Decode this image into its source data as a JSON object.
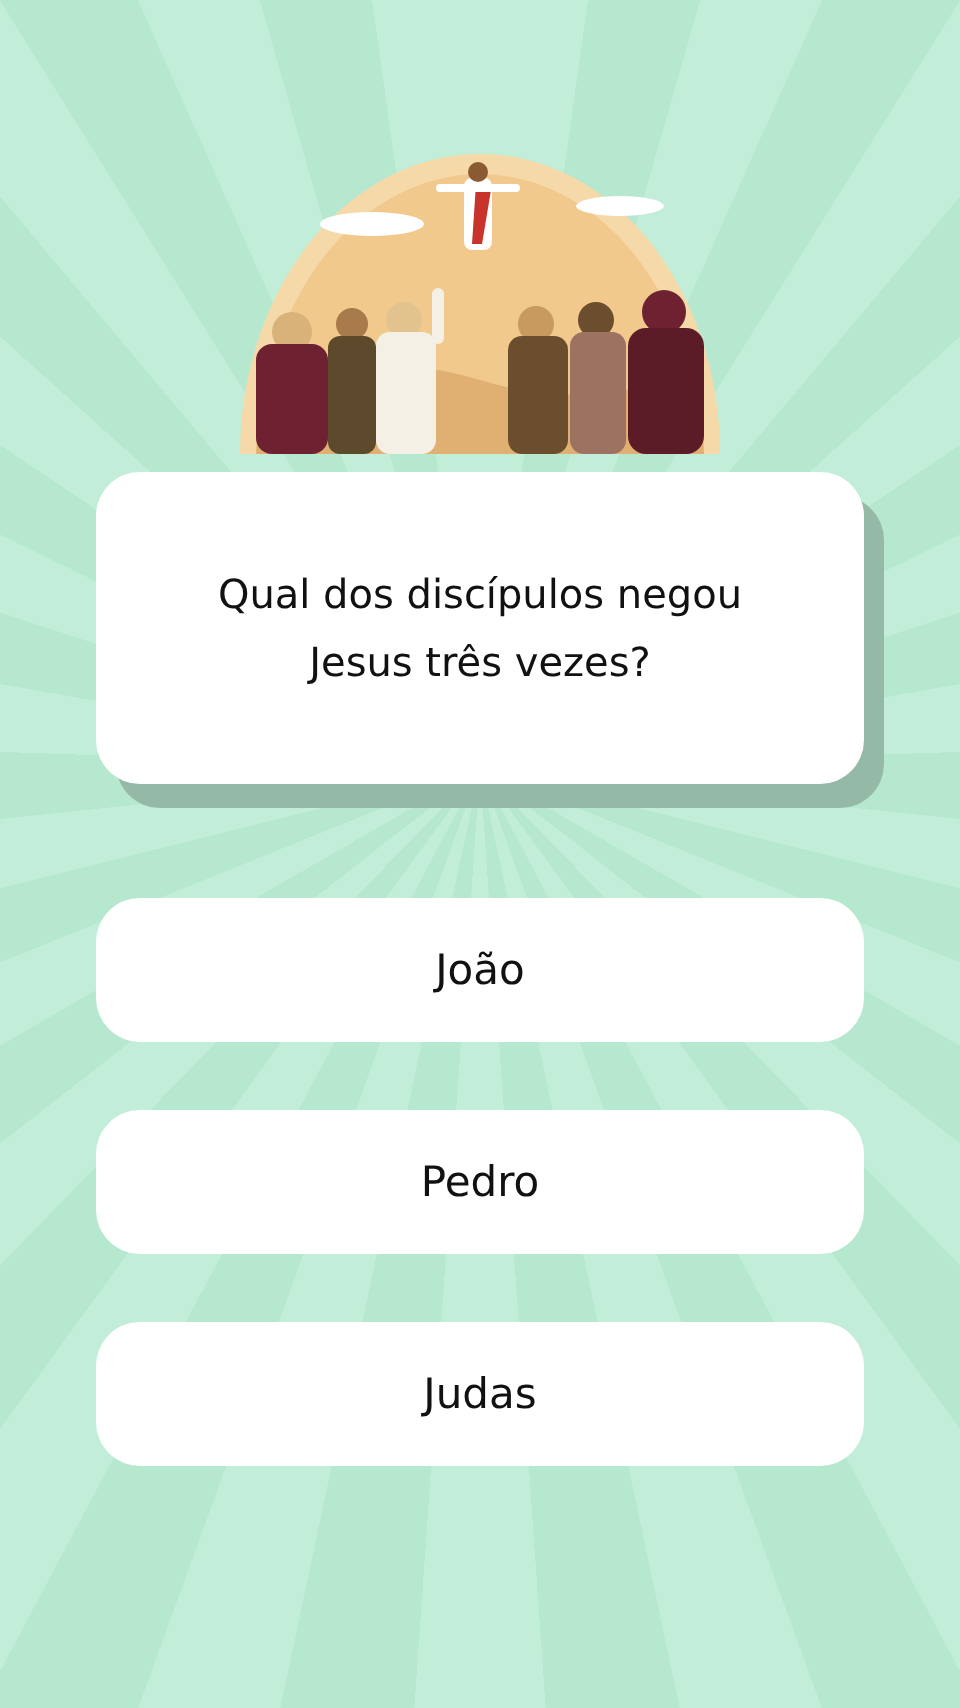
{
  "question": "Qual dos discípulos negou Jesus três vezes?",
  "answers": [
    {
      "label": "João"
    },
    {
      "label": "Pedro"
    },
    {
      "label": "Judas"
    }
  ]
}
